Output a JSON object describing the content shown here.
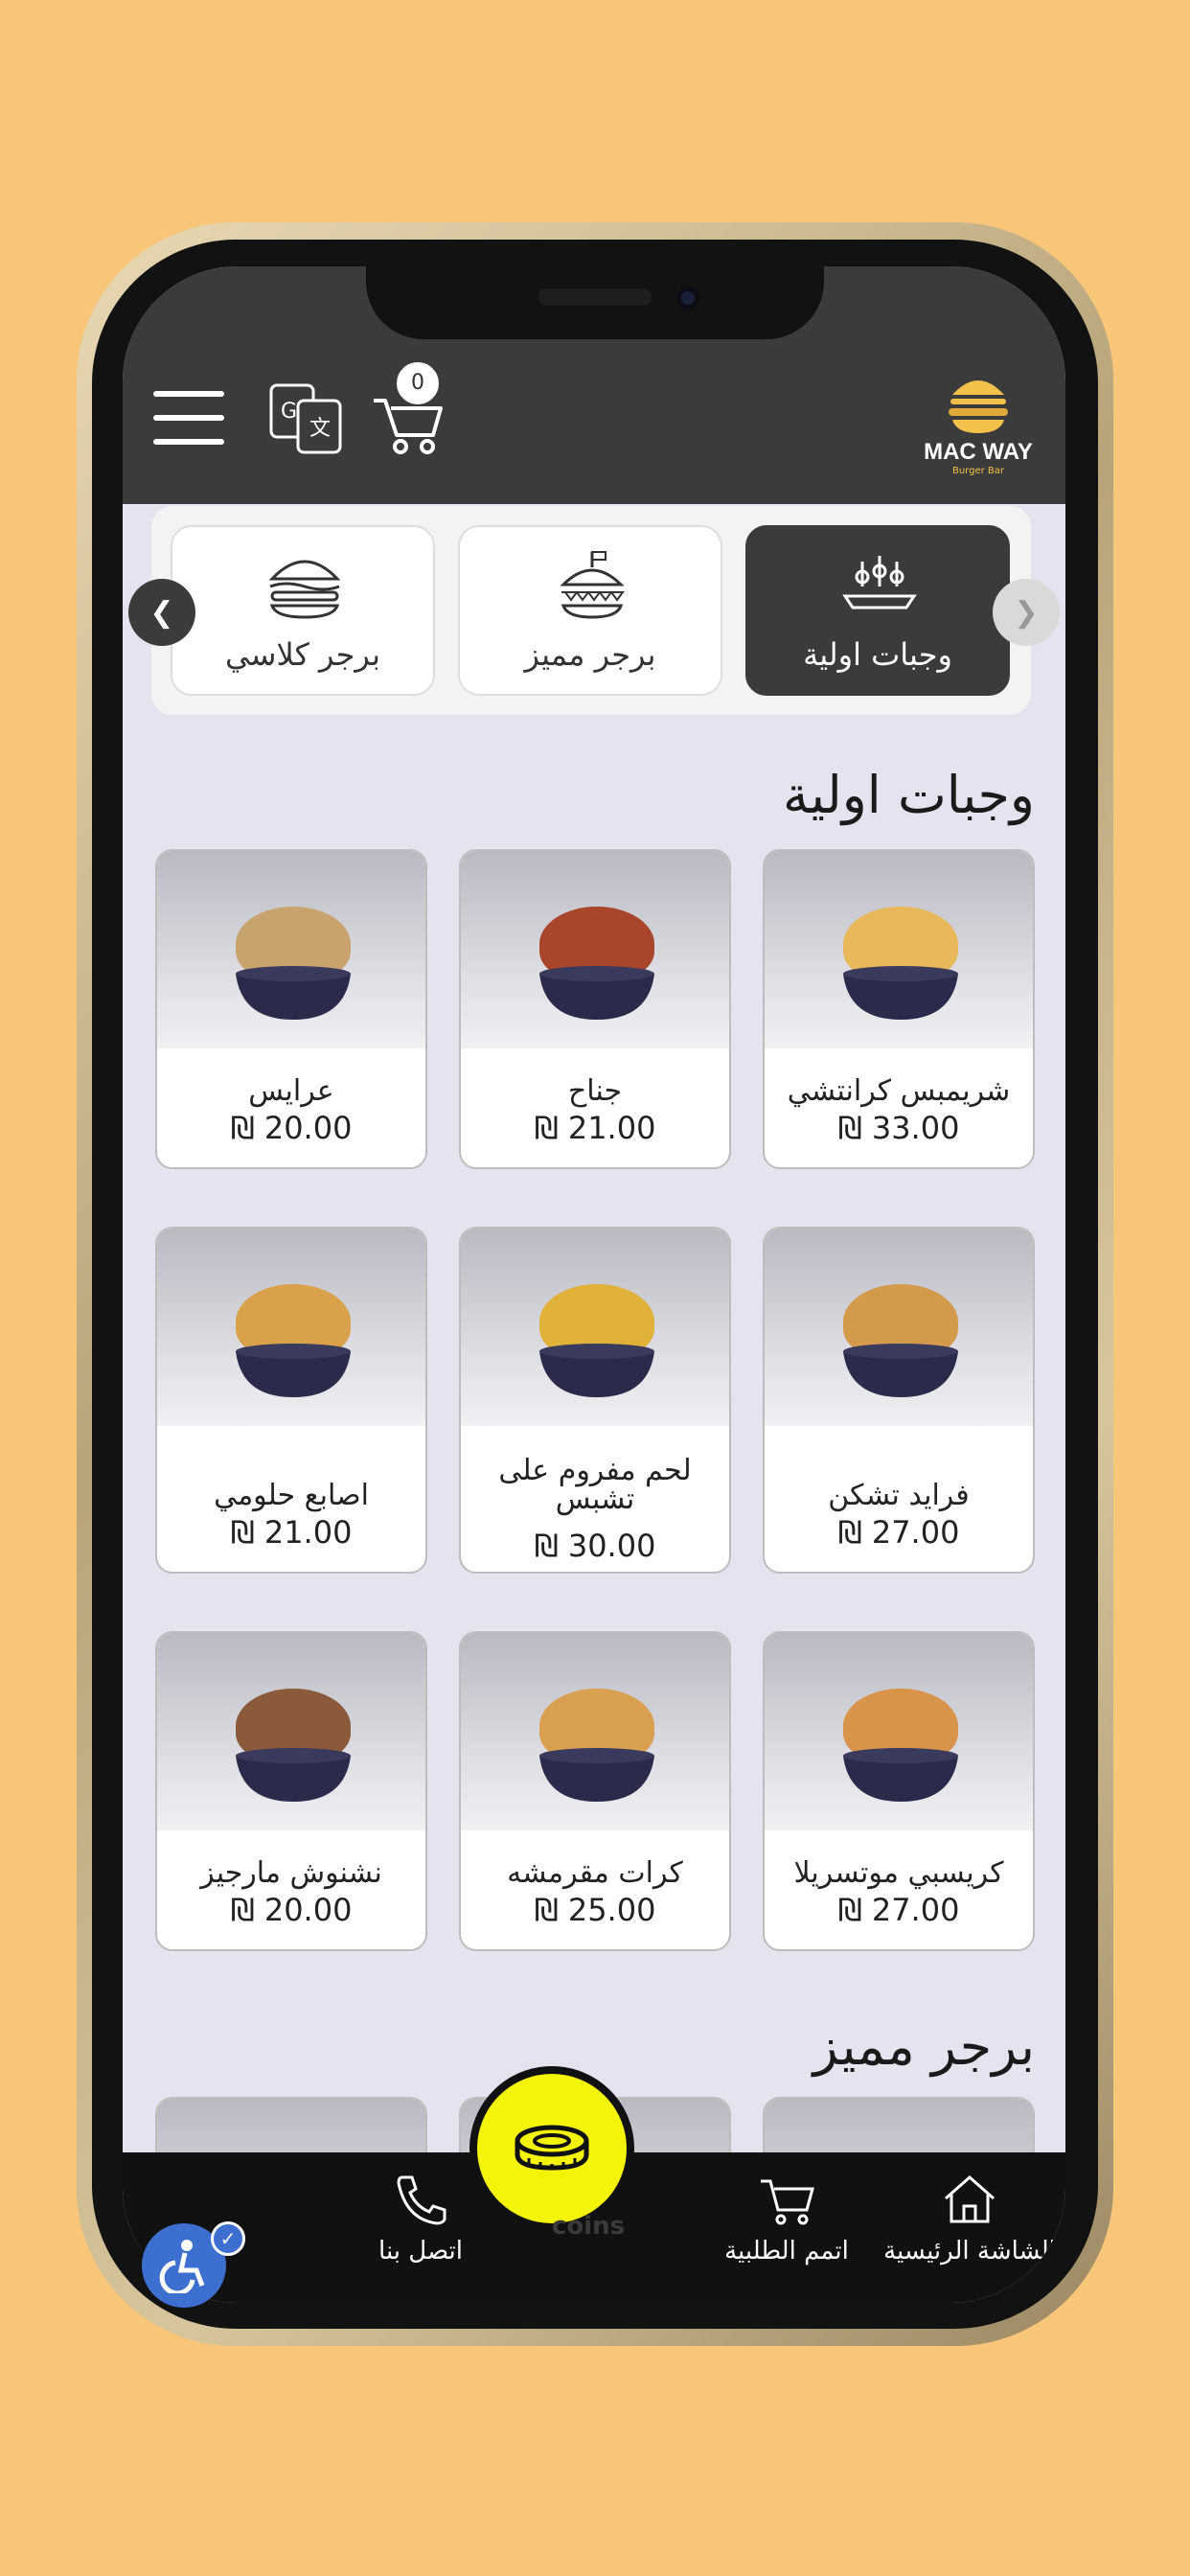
{
  "header": {
    "cart_count": "0",
    "logo_title": "MAC WAY",
    "logo_subtitle": "Burger Bar"
  },
  "categories": [
    {
      "label": "وجبات اولية",
      "icon": "appetizer-platter-icon",
      "active": true
    },
    {
      "label": "برجر مميز",
      "icon": "premium-burger-icon",
      "active": false
    },
    {
      "label": "برجر كلاسي",
      "icon": "classic-burger-icon",
      "active": false
    }
  ],
  "sections": [
    {
      "title": "وجبات اولية",
      "items": [
        {
          "name": "شريمبس كرانتشي",
          "price": "₪ 33.00"
        },
        {
          "name": "جناح",
          "price": "₪ 21.00"
        },
        {
          "name": "عرايس",
          "price": "₪ 20.00"
        },
        {
          "name": "فرايد تشكن",
          "price": "₪ 27.00"
        },
        {
          "name": "لحم مفروم على تشبس",
          "price": "₪ 30.00"
        },
        {
          "name": "اصابع حلومي",
          "price": "₪ 21.00"
        },
        {
          "name": "كريسبي موتسريلا",
          "price": "₪ 27.00"
        },
        {
          "name": "كرات مقرمشه",
          "price": "₪ 25.00"
        },
        {
          "name": "نشنوش مارجيز",
          "price": "₪ 20.00"
        }
      ]
    },
    {
      "title": "برجر مميز"
    }
  ],
  "bottom_nav": {
    "home": "الشاشة الرئيسية",
    "complete_order": "اتمم الطلبية",
    "coins": "coins",
    "contact": "اتصل بنا"
  },
  "colors": {
    "page_background": "#f7c679",
    "header_background": "#3b3b3b",
    "coin_button": "#f4f30a",
    "accessibility": "#3d6fd1"
  }
}
